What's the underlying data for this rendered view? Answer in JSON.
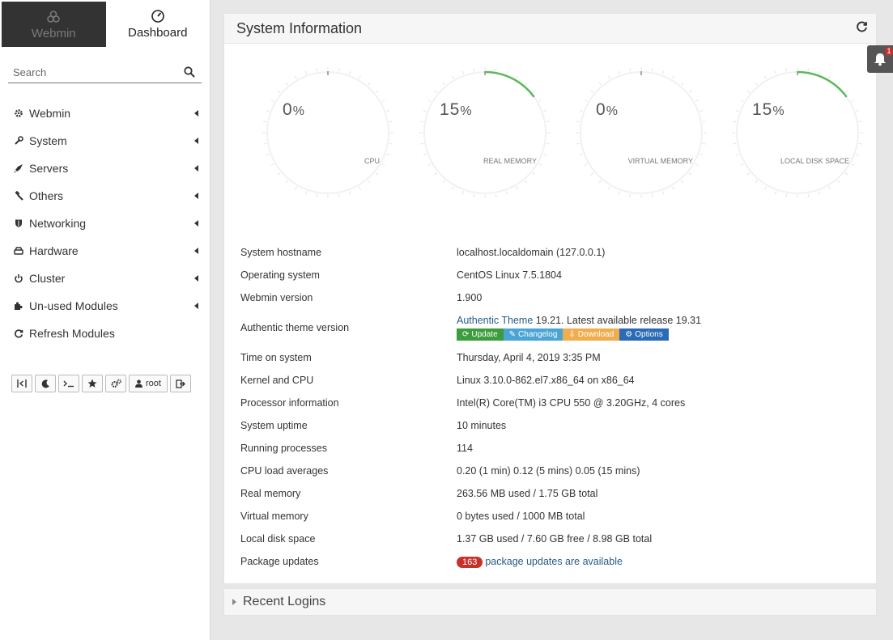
{
  "sidebar": {
    "tabs": [
      {
        "label": "Webmin",
        "icon": "webmin-logo-icon"
      },
      {
        "label": "Dashboard",
        "icon": "dashboard-gauge-icon"
      }
    ],
    "search_placeholder": "Search",
    "menu": [
      {
        "label": "Webmin",
        "icon": "gear-icon"
      },
      {
        "label": "System",
        "icon": "wrench-icon"
      },
      {
        "label": "Servers",
        "icon": "rocket-icon"
      },
      {
        "label": "Others",
        "icon": "gavel-icon"
      },
      {
        "label": "Networking",
        "icon": "shield-icon"
      },
      {
        "label": "Hardware",
        "icon": "hdd-icon"
      },
      {
        "label": "Cluster",
        "icon": "power-icon"
      },
      {
        "label": "Un-used Modules",
        "icon": "puzzle-icon"
      },
      {
        "label": "Refresh Modules",
        "icon": "refresh-icon"
      }
    ],
    "toolbar_user": "root"
  },
  "system_info": {
    "title": "System Information",
    "gauges": [
      {
        "value": "0",
        "unit": "%",
        "label": "CPU",
        "fraction": 0.0
      },
      {
        "value": "15",
        "unit": "%",
        "label": "REAL MEMORY",
        "fraction": 0.15
      },
      {
        "value": "0",
        "unit": "%",
        "label": "VIRTUAL MEMORY",
        "fraction": 0.0
      },
      {
        "value": "15",
        "unit": "%",
        "label": "LOCAL DISK SPACE",
        "fraction": 0.15
      }
    ],
    "rows": {
      "hostname": {
        "label": "System hostname",
        "value": "localhost.localdomain (127.0.0.1)"
      },
      "os": {
        "label": "Operating system",
        "value": "CentOS Linux 7.5.1804"
      },
      "webmin_version": {
        "label": "Webmin version",
        "value": "1.900"
      },
      "theme": {
        "label": "Authentic theme version",
        "link": "Authentic Theme",
        "value": " 19.21. Latest available release 19.31"
      },
      "time": {
        "label": "Time on system",
        "value": "Thursday, April 4, 2019 3:35 PM"
      },
      "kernel": {
        "label": "Kernel and CPU",
        "value": "Linux 3.10.0-862.el7.x86_64 on x86_64"
      },
      "processor": {
        "label": "Processor information",
        "value": "Intel(R) Core(TM) i3 CPU 550 @ 3.20GHz, 4 cores"
      },
      "uptime": {
        "label": "System uptime",
        "value": "10 minutes"
      },
      "processes": {
        "label": "Running processes",
        "value": "114"
      },
      "load": {
        "label": "CPU load averages",
        "value": "0.20 (1 min) 0.12 (5 mins) 0.05 (15 mins)"
      },
      "real_memory": {
        "label": "Real memory",
        "value": "263.56 MB used / 1.75 GB total"
      },
      "virtual_memory": {
        "label": "Virtual memory",
        "value": "0 bytes used / 1000 MB total"
      },
      "disk": {
        "label": "Local disk space",
        "value": "1.37 GB used / 7.60 GB free / 8.98 GB total"
      },
      "packages": {
        "label": "Package updates",
        "count": "163",
        "value": "package updates are available"
      }
    },
    "theme_buttons": [
      {
        "label": "Update",
        "color": "#3c9d3c"
      },
      {
        "label": "Changelog",
        "color": "#4ba5d4"
      },
      {
        "label": "Download",
        "color": "#f0ad4e"
      },
      {
        "label": "Options",
        "color": "#2a6bb5"
      }
    ]
  },
  "recent_logins": {
    "title": "Recent Logins"
  },
  "notifications": {
    "count": "1"
  },
  "colors": {
    "gauge_fill": "#5cb85c",
    "link": "#285c86",
    "badge_red": "#c9302c"
  }
}
